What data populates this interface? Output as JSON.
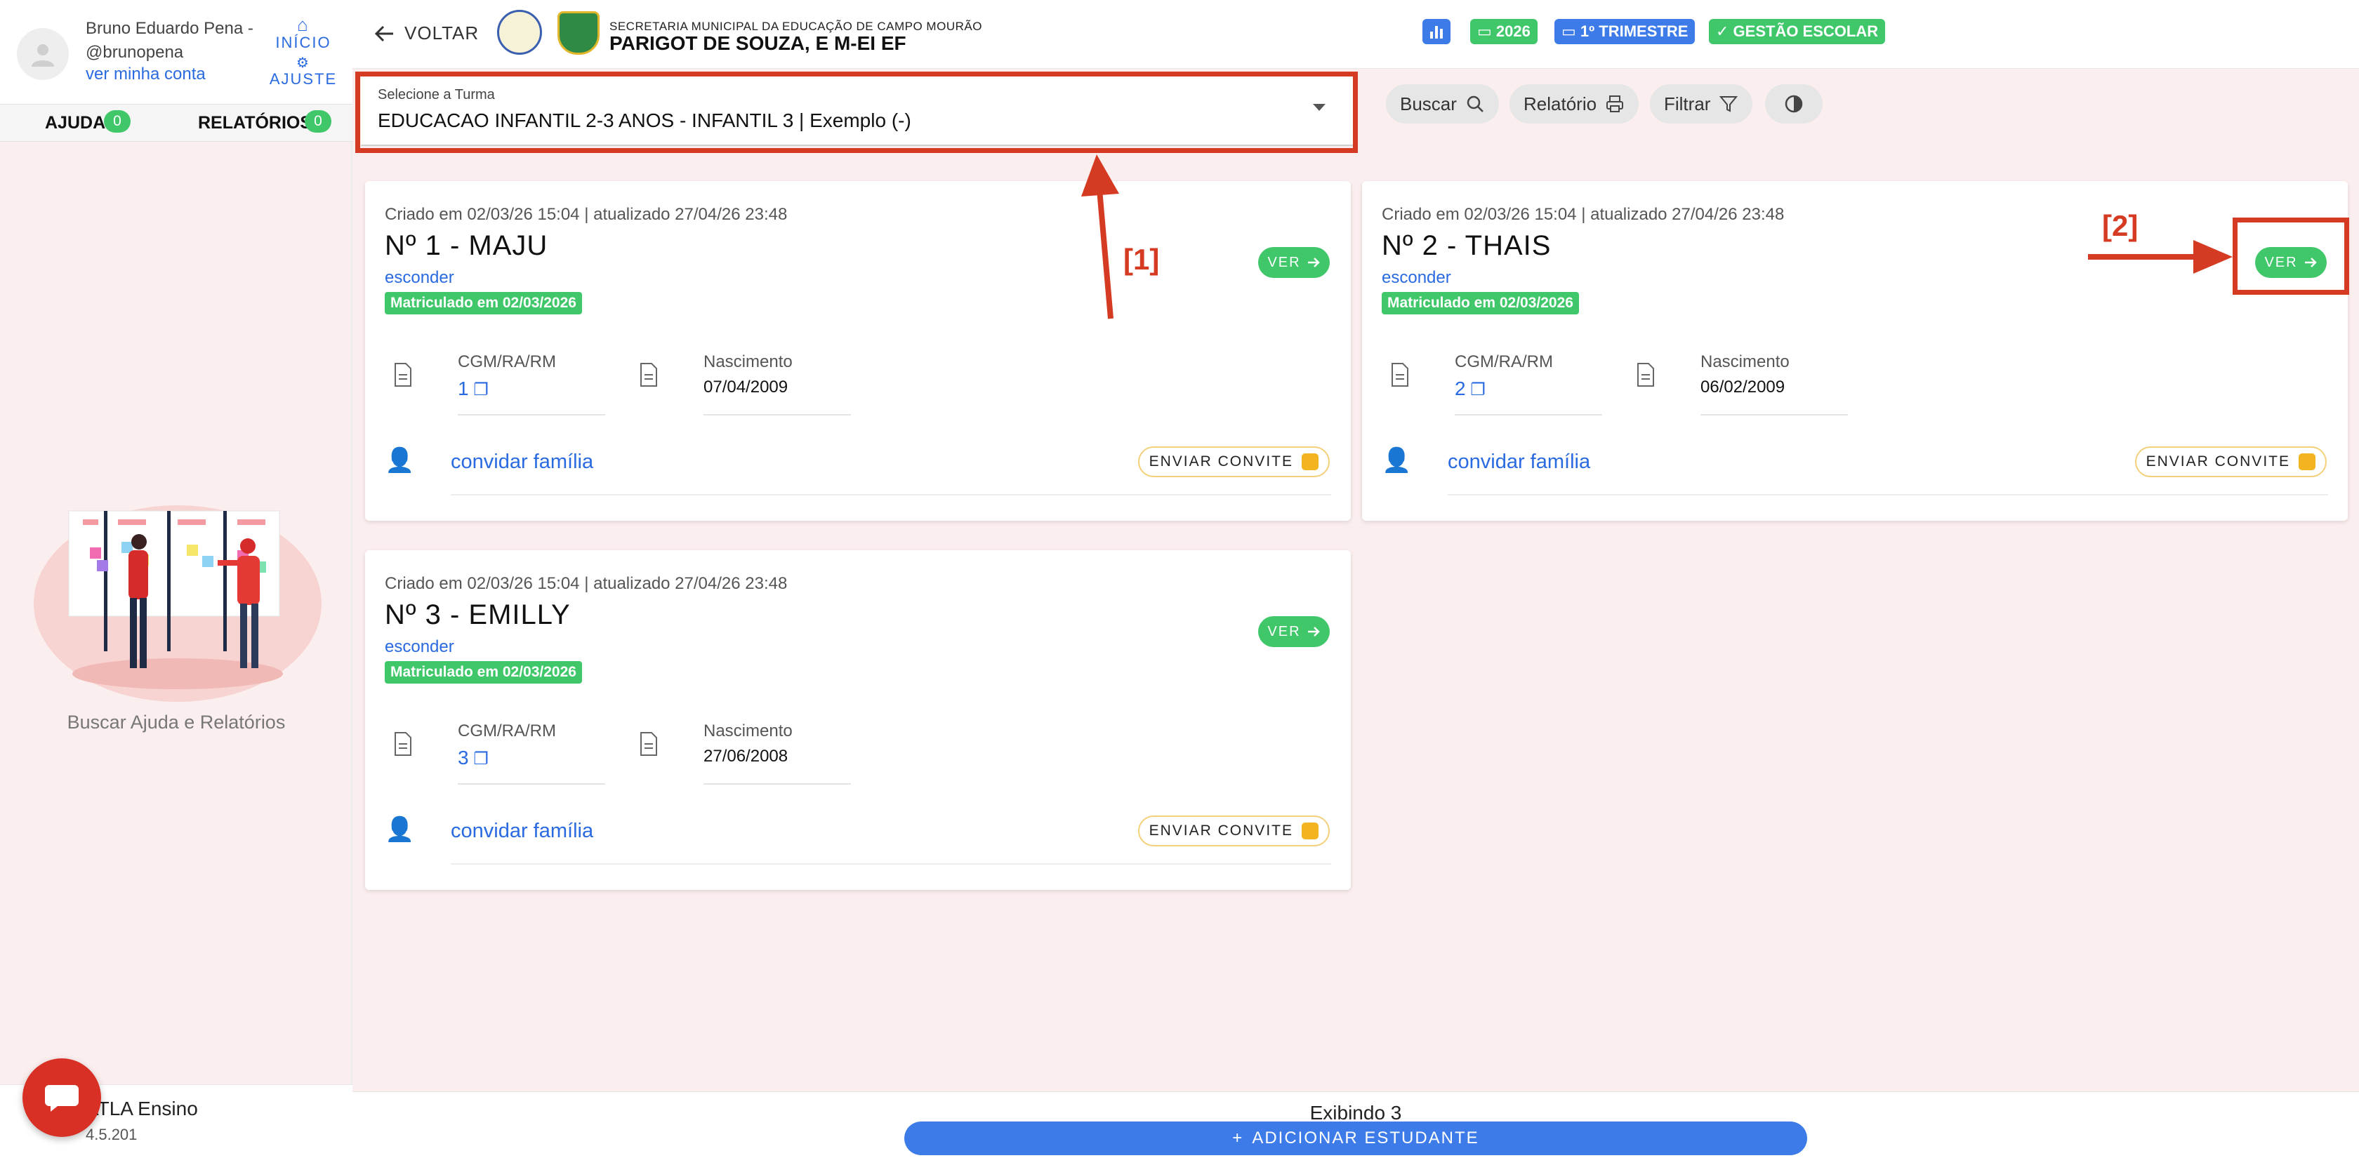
{
  "sidebar": {
    "profile": {
      "name": "Bruno Eduardo Pena - @brunopena",
      "account_link": "ver minha conta"
    },
    "nav": {
      "inicio": "INÍCIO",
      "ajuste": "AJUSTE"
    },
    "tabs": [
      {
        "label": "AJUDA",
        "count": "0"
      },
      {
        "label": "RELATÓRIOS",
        "count": "0"
      }
    ],
    "help_text": "Buscar Ajuda e Relatórios",
    "brand": {
      "name": "ATLA Ensino",
      "version": "4.5.201"
    }
  },
  "header": {
    "back_label": "VOLTAR",
    "org_subtitle": "SECRETARIA MUNICIPAL DA EDUCAÇÃO DE CAMPO MOURÃO",
    "org_title": "PARIGOT DE SOUZA, E M-EI EF",
    "chips": {
      "year": "2026",
      "term": "1º TRIMESTRE",
      "module": "GESTÃO ESCOLAR"
    },
    "colors": {
      "green": "#3fc76a",
      "blue": "#3d7be8"
    }
  },
  "toolbar": {
    "class_select": {
      "label": "Selecione a Turma",
      "value": "EDUCACAO INFANTIL 2-3 ANOS - INFANTIL 3 | Exemplo (-)"
    },
    "buttons": {
      "search": "Buscar",
      "report": "Relatório",
      "filter": "Filtrar"
    }
  },
  "students": [
    {
      "meta": "Criado em 02/03/26 15:04 | atualizado 27/04/26 23:48",
      "name": "Nº 1 - MAJU",
      "hide": "esconder",
      "badge": "Matriculado em 02/03/2026",
      "view": "VER",
      "id_label": "CGM/RA/RM",
      "id_value": "1",
      "birth_label": "Nascimento",
      "birth_value": "07/04/2009",
      "invite_link": "convidar família",
      "invite_button": "ENVIAR CONVITE"
    },
    {
      "meta": "Criado em 02/03/26 15:04 | atualizado 27/04/26 23:48",
      "name": "Nº 2 - THAIS",
      "hide": "esconder",
      "badge": "Matriculado em 02/03/2026",
      "view": "VER",
      "id_label": "CGM/RA/RM",
      "id_value": "2",
      "birth_label": "Nascimento",
      "birth_value": "06/02/2009",
      "invite_link": "convidar família",
      "invite_button": "ENVIAR CONVITE"
    },
    {
      "meta": "Criado em 02/03/26 15:04 | atualizado 27/04/26 23:48",
      "name": "Nº 3 - EMILLY",
      "hide": "esconder",
      "badge": "Matriculado em 02/03/2026",
      "view": "VER",
      "id_label": "CGM/RA/RM",
      "id_value": "3",
      "birth_label": "Nascimento",
      "birth_value": "27/06/2008",
      "invite_link": "convidar família",
      "invite_button": "ENVIAR CONVITE"
    }
  ],
  "footer": {
    "showing": "Exibindo 3",
    "add_button": "ADICIONAR ESTUDANTE"
  },
  "annotations": {
    "one": "[1]",
    "two": "[2]"
  }
}
